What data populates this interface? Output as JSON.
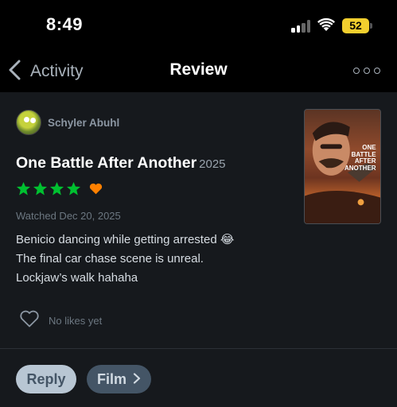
{
  "status_bar": {
    "time": "8:49",
    "battery": "52",
    "icons": [
      "cellular-signal-icon",
      "wifi-icon",
      "battery-icon"
    ]
  },
  "nav": {
    "back_label": "Activity",
    "title": "Review",
    "icons": [
      "chevron-left-icon",
      "more-icon"
    ]
  },
  "review": {
    "author": "Schyler Abuhl",
    "film_title": "One Battle After Another",
    "film_year": "2025",
    "stars": 4,
    "liked": true,
    "watched": "Watched Dec 20, 2025",
    "lines": [
      "Benicio dancing while getting arrested 😂",
      "The final car chase scene is unreal.",
      "Lockjaw’s walk hahaha"
    ],
    "poster_text": [
      "ONE",
      "BATTLE",
      "AFTER",
      "ANOTHER"
    ],
    "likes_label": "No likes yet"
  },
  "actions": {
    "reply_label": "Reply",
    "film_label": "Film"
  },
  "colors": {
    "star": "#00c030",
    "heart": "#ff8000",
    "background": "#16191d",
    "nav_background": "#000000",
    "battery": "#f2cf2e"
  }
}
